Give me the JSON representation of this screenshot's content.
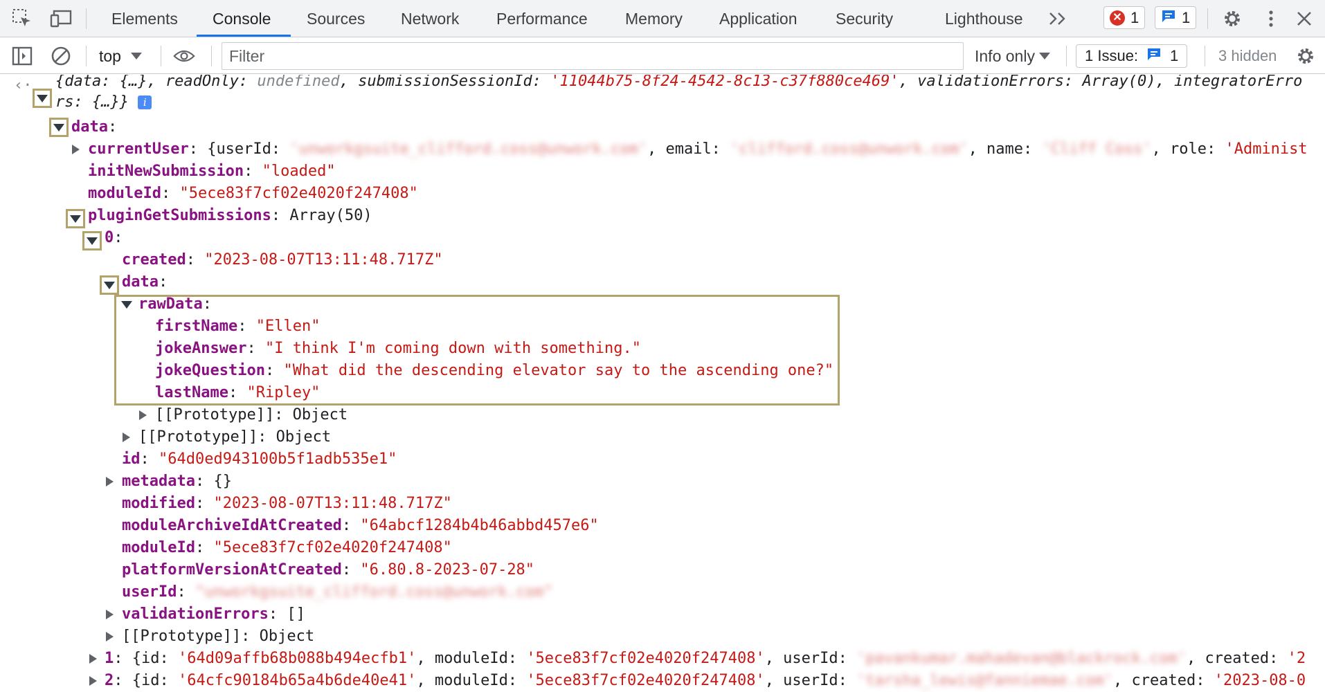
{
  "devtools": {
    "tabs": [
      "Elements",
      "Console",
      "Sources",
      "Network",
      "Performance",
      "Memory",
      "Application",
      "Security",
      "Lighthouse"
    ],
    "active_tab": "Console",
    "error_count": "1",
    "message_count": "1"
  },
  "toolbar": {
    "context": "top",
    "filter_placeholder": "Filter",
    "levels": "Info only",
    "issues_label": "1 Issue:",
    "issues_count": "1",
    "hidden": "3 hidden"
  },
  "console": {
    "summary": {
      "part1": "{data: {…}, readOnly: ",
      "undef": "undefined",
      "part2": ", submissionSessionId: ",
      "session_id": "'11044b75-8f24-4542-8c13-c37f880ce469'",
      "part3": ", validationErrors: Array(0), integratorErro",
      "wrap": "rs: {…}}"
    },
    "data_key": "data",
    "current_user": {
      "key": "currentUser",
      "open": ": {userId: ",
      "user_id": "'unworkgsuite_clifford.coss@unwork.com'",
      "email_key": ", email: ",
      "email": "'clifford.coss@unwork.com'",
      "name_key": ", name: ",
      "name": "'Cliff Coss'",
      "role_key": ", role: ",
      "role": "'Administ"
    },
    "init_new_submission": {
      "key": "initNewSubmission",
      "value": "\"loaded\""
    },
    "module_id": {
      "key": "moduleId",
      "value": "\"5ece83f7cf02e4020f247408\""
    },
    "plugin_get_submissions": {
      "key": "pluginGetSubmissions",
      "value": "Array(50)"
    },
    "item0": {
      "index": "0",
      "created": {
        "key": "created",
        "value": "\"2023-08-07T13:11:48.717Z\""
      },
      "data_key": "data",
      "raw_data_key": "rawData",
      "raw": [
        {
          "key": "firstName",
          "value": "\"Ellen\""
        },
        {
          "key": "jokeAnswer",
          "value": "\"I think I'm coming down with something.\""
        },
        {
          "key": "jokeQuestion",
          "value": "\"What did the descending elevator say to the ascending one?\""
        },
        {
          "key": "lastName",
          "value": "\"Ripley\""
        }
      ],
      "proto_inner": "[[Prototype]]: Object",
      "proto_data": "[[Prototype]]: Object",
      "id": {
        "key": "id",
        "value": "\"64d0ed943100b5f1adb535e1\""
      },
      "metadata": {
        "key": "metadata",
        "value": "{}"
      },
      "modified": {
        "key": "modified",
        "value": "\"2023-08-07T13:11:48.717Z\""
      },
      "module_archive": {
        "key": "moduleArchiveIdAtCreated",
        "value": "\"64abcf1284b4b46abbd457e6\""
      },
      "module_id": {
        "key": "moduleId",
        "value": "\"5ece83f7cf02e4020f247408\""
      },
      "platform_version": {
        "key": "platformVersionAtCreated",
        "value": "\"6.80.8-2023-07-28\""
      },
      "user_id": {
        "key": "userId",
        "value": "\"unworkgsuite_clifford.coss@unwork.com\""
      },
      "validation_errors": {
        "key": "validationErrors",
        "value": "[]"
      },
      "proto_item": "[[Prototype]]: Object"
    },
    "item1": {
      "index": "1",
      "open": "{id: ",
      "id": "'64d09affb68b088b494ecfb1'",
      "module_key": ", moduleId: ",
      "module_id": "'5ece83f7cf02e4020f247408'",
      "user_key": ", userId: ",
      "user_id": "'pavankumar.mahadevan@blackrock.com'",
      "created_key": ", created: ",
      "created": "'2"
    },
    "item2": {
      "index": "2",
      "open": "{id: ",
      "id": "'64cfc90184b65a4b6de40e41'",
      "module_key": ", moduleId: ",
      "module_id": "'5ece83f7cf02e4020f247408'",
      "user_key": ", userId: ",
      "user_id": "'tarsha_lewis@fanniemae.com'",
      "created_key": ", created: ",
      "created": "'2023-08-0"
    }
  }
}
